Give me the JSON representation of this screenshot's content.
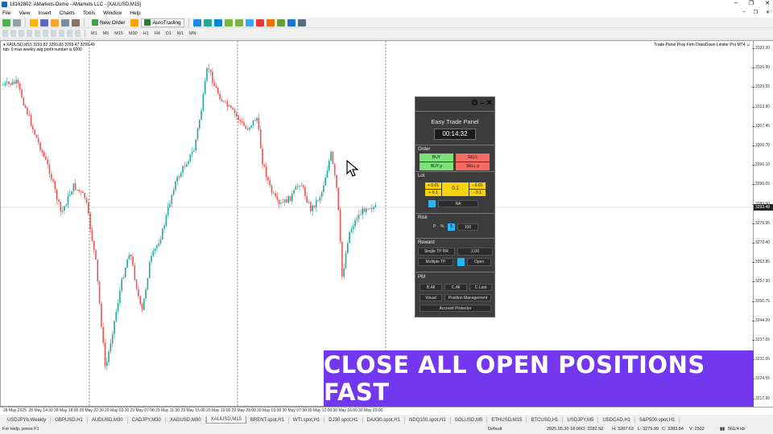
{
  "window": {
    "title": "18162802: AMarkets-Demo - AMarkets LLC - [XAUUSD,M15]",
    "controls": [
      "–",
      "❐",
      "✕"
    ]
  },
  "menu": {
    "items": [
      "File",
      "View",
      "Insert",
      "Charts",
      "Tools",
      "Window",
      "Help"
    ],
    "mdi_controls": [
      "–",
      "❐",
      "✕"
    ]
  },
  "toolbar": {
    "new_order_label": "New Order",
    "autotrading_label": "AutoTrading",
    "timeframes": [
      "M1",
      "M5",
      "M15",
      "M30",
      "H1",
      "H4",
      "D1",
      "W1",
      "MN"
    ]
  },
  "chart": {
    "info_line1": "▾ XAUUSD,M15  3293.82 3293.83 3293.47 3293.49",
    "info_line2": "tab: 0 max weekly avg profit number is 6000",
    "ea_label": "Trade Panel Prop Firm DrawDown Limiter Pro MT4 ☺",
    "current_price": "3293.49",
    "y_ticks": [
      "3333.30",
      "3326.90",
      "3320.55",
      "3313.90",
      "3307.45",
      "3300.70",
      "3296.10",
      "3290.05",
      "3283.50",
      "3276.95",
      "3270.40",
      "3263.85",
      "3257.30",
      "3250.75",
      "3244.20",
      "3237.65",
      "3231.05",
      "3224.55",
      "3217.95"
    ],
    "x_ticks": [
      "28 May 2025",
      "28 May 14:30",
      "28 May 18:00",
      "28 May 22:30",
      "29 May 03:30",
      "29 May 07:00",
      "29 May 11:30",
      "29 May 15:00",
      "29 May 19:00",
      "29 May 23:00",
      "30 May 03:00",
      "30 May 07:30",
      "30 May 12:00",
      "30 May 16:00",
      "30 May 20:00"
    ]
  },
  "panel": {
    "title": "Easy Trade Panel",
    "timer": "00:14:32",
    "order": {
      "label": "Order",
      "buy": "BUY",
      "sell": "SELL",
      "buy_p": "BUY p",
      "sell_p": "SELL p"
    },
    "lot": {
      "label": "Lot",
      "plus_001": "+ 0.01",
      "plus_01": "+ 0.1",
      "value": "0.1",
      "minus_001": "- 0.01",
      "minus_01": "- 0.1",
      "na": "NA"
    },
    "risk": {
      "label": "Risk",
      "p": "P",
      "pct": "%",
      "dollar": "$",
      "value": "100"
    },
    "reward": {
      "label": "Reward",
      "single_tp": "Single TP RR",
      "single_value": "2.00",
      "multiple_tp": "Multiple TP",
      "open": "Open"
    },
    "pm": {
      "label": "PM",
      "b_all": "B.All",
      "c_all": "C.All",
      "c_last": "C.Last",
      "visual": "Visual",
      "position_mgmt": "Position Management",
      "account_protector": "Account Protector"
    }
  },
  "banner_text": "CLOSE ALL OPEN POSITIONS FAST",
  "tabs": [
    "USDJPYb,Weekly",
    "GBPUSD,H1",
    "AUDUSD,M30",
    "CADJPY,M30",
    "XAGUSD,M30",
    "XAUUSD,M15",
    "BRENT.spot,H1",
    "WTI.spot,H1",
    "DJ30.spot,H1",
    "DAX30.spot,H1",
    "NDQ100.spot,H1",
    "SOLUSD,M5",
    "ETHUSD,M15",
    "BTCUSD,H1",
    "USDJPY,M5",
    "USDCAD,H1",
    "S&P500.spot,H1"
  ],
  "status": {
    "help": "For Help, press F1",
    "profile": "Default",
    "datetime": "2025.05.30 18:00",
    "open": "O: 3282.52",
    "high": "H: 3287.63",
    "low": "L: 3275.99",
    "close": "C: 3283.84",
    "volume": "V: 2502",
    "traffic": "561/4 kb"
  },
  "colors": {
    "bull": "#26a69a",
    "bear": "#ef5350",
    "banner": "#7437f0"
  }
}
